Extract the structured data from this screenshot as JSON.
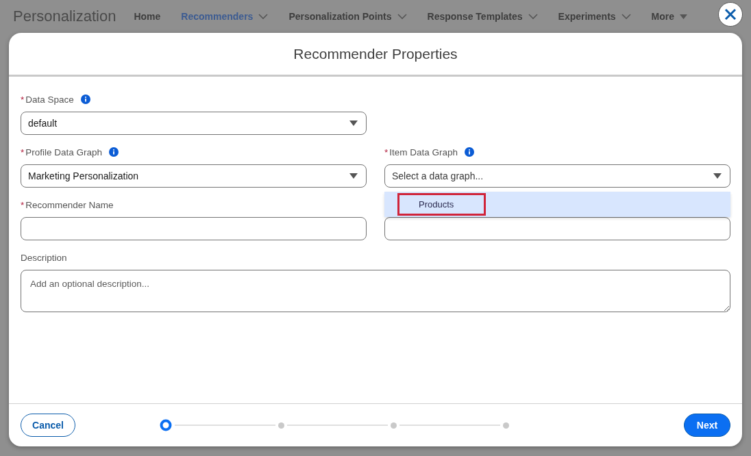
{
  "app": {
    "title": "Personalization"
  },
  "nav": [
    {
      "label": "Home",
      "selected": false,
      "kind": "plain"
    },
    {
      "label": "Recommenders",
      "selected": true,
      "kind": "menu"
    },
    {
      "label": "Personalization Points",
      "selected": false,
      "kind": "menu"
    },
    {
      "label": "Response Templates",
      "selected": false,
      "kind": "menu"
    },
    {
      "label": "Experiments",
      "selected": false,
      "kind": "menu"
    },
    {
      "label": "More",
      "selected": false,
      "kind": "overflow"
    }
  ],
  "modal": {
    "title": "Recommender Properties",
    "rows": [
      [
        {
          "kind": "select",
          "label": "Data Space",
          "required_mark": "*",
          "info": true,
          "value": "default"
        }
      ],
      [
        {
          "kind": "select",
          "label": "Profile Data Graph",
          "required_mark": "*",
          "info": true,
          "value": "Marketing Personalization"
        },
        {
          "kind": "select",
          "label": "Item Data Graph",
          "required_mark": "*",
          "info": true,
          "placeholder": "Select a data graph...",
          "open": true,
          "options": [
            {
              "label": "Products",
              "highlighted": true
            }
          ]
        }
      ],
      [
        {
          "kind": "text",
          "label": "Recommender Name",
          "required_mark": "*"
        },
        {
          "kind": "text"
        }
      ]
    ],
    "description": {
      "label": "Description",
      "placeholder": "Add an optional description..."
    },
    "steps": [
      {
        "selected": true
      },
      {
        "selected": false
      },
      {
        "selected": false
      },
      {
        "selected": false
      }
    ],
    "buttons": [
      {
        "label": "Cancel",
        "kind": "neutral"
      },
      {
        "label": "Next",
        "kind": "brand"
      }
    ]
  }
}
